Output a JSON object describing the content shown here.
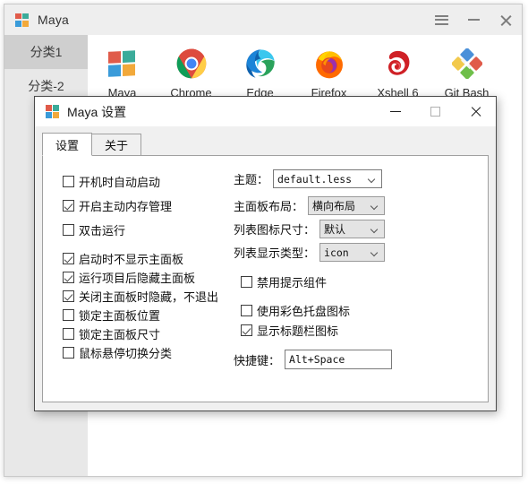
{
  "main_window": {
    "title": "Maya",
    "logo_icon": "windows-squares-icon",
    "controls": [
      {
        "name": "menu-button",
        "icon": "hamburger-icon"
      },
      {
        "name": "minimize-button",
        "icon": "minimize-icon"
      },
      {
        "name": "close-button",
        "icon": "close-icon"
      }
    ],
    "sidebar": {
      "items": [
        {
          "label": "分类1",
          "active": true
        },
        {
          "label": "分类-2",
          "active": false
        }
      ]
    },
    "apps": [
      {
        "label": "Maya",
        "icon": "maya-windows-squares-icon"
      },
      {
        "label": "Chrome",
        "icon": "chrome-icon"
      },
      {
        "label": "Edge",
        "icon": "edge-icon"
      },
      {
        "label": "Firefox",
        "icon": "firefox-icon"
      },
      {
        "label": "Xshell 6",
        "icon": "xshell-icon"
      },
      {
        "label": "Git Bash",
        "icon": "git-bash-icon"
      }
    ]
  },
  "settings_dialog": {
    "title": "Maya 设置",
    "logo_icon": "windows-squares-icon",
    "controls": [
      {
        "name": "minimize-button",
        "icon": "minimize-icon"
      },
      {
        "name": "maximize-button",
        "icon": "maximize-icon"
      },
      {
        "name": "close-button",
        "icon": "close-icon"
      }
    ],
    "tabs": [
      {
        "label": "设置",
        "active": true
      },
      {
        "label": "关于",
        "active": false
      }
    ],
    "checkboxes_left": [
      {
        "label": "开机时自动启动",
        "checked": false
      },
      {
        "label": "开启主动内存管理",
        "checked": true
      },
      {
        "label": "双击运行",
        "checked": false
      },
      {
        "label": "启动时不显示主面板",
        "checked": true
      },
      {
        "label": "运行项目后隐藏主面板",
        "checked": true
      },
      {
        "label": "关闭主面板时隐藏，不退出",
        "checked": true
      },
      {
        "label": "锁定主面板位置",
        "checked": false
      },
      {
        "label": "锁定主面板尺寸",
        "checked": false
      },
      {
        "label": "鼠标悬停切换分类",
        "checked": false
      }
    ],
    "selects": [
      {
        "label": "主题：",
        "value": "default.less",
        "style": "white",
        "mono": true
      },
      {
        "label": "主面板布局：",
        "value": "横向布局",
        "style": "gray",
        "mono": false
      },
      {
        "label": "列表图标尺寸：",
        "value": "默认",
        "style": "gray",
        "mono": false
      },
      {
        "label": "列表显示类型：",
        "value": "icon",
        "style": "gray",
        "mono": true
      }
    ],
    "checkboxes_right": [
      {
        "label": "禁用提示组件",
        "checked": false
      },
      {
        "label": "使用彩色托盘图标",
        "checked": false
      },
      {
        "label": "显示标题栏图标",
        "checked": true
      }
    ],
    "shortcut": {
      "label": "快捷键：",
      "value": "Alt+Space"
    }
  },
  "colors": {
    "titlebar": "#eeeeee",
    "sidebar": "#e8e8e8",
    "sidebar_active": "#cfcfcf",
    "dialog_bg": "#f0f0f0",
    "panel_bg": "#ffffff",
    "combo_gray": "#e4e4e4"
  }
}
